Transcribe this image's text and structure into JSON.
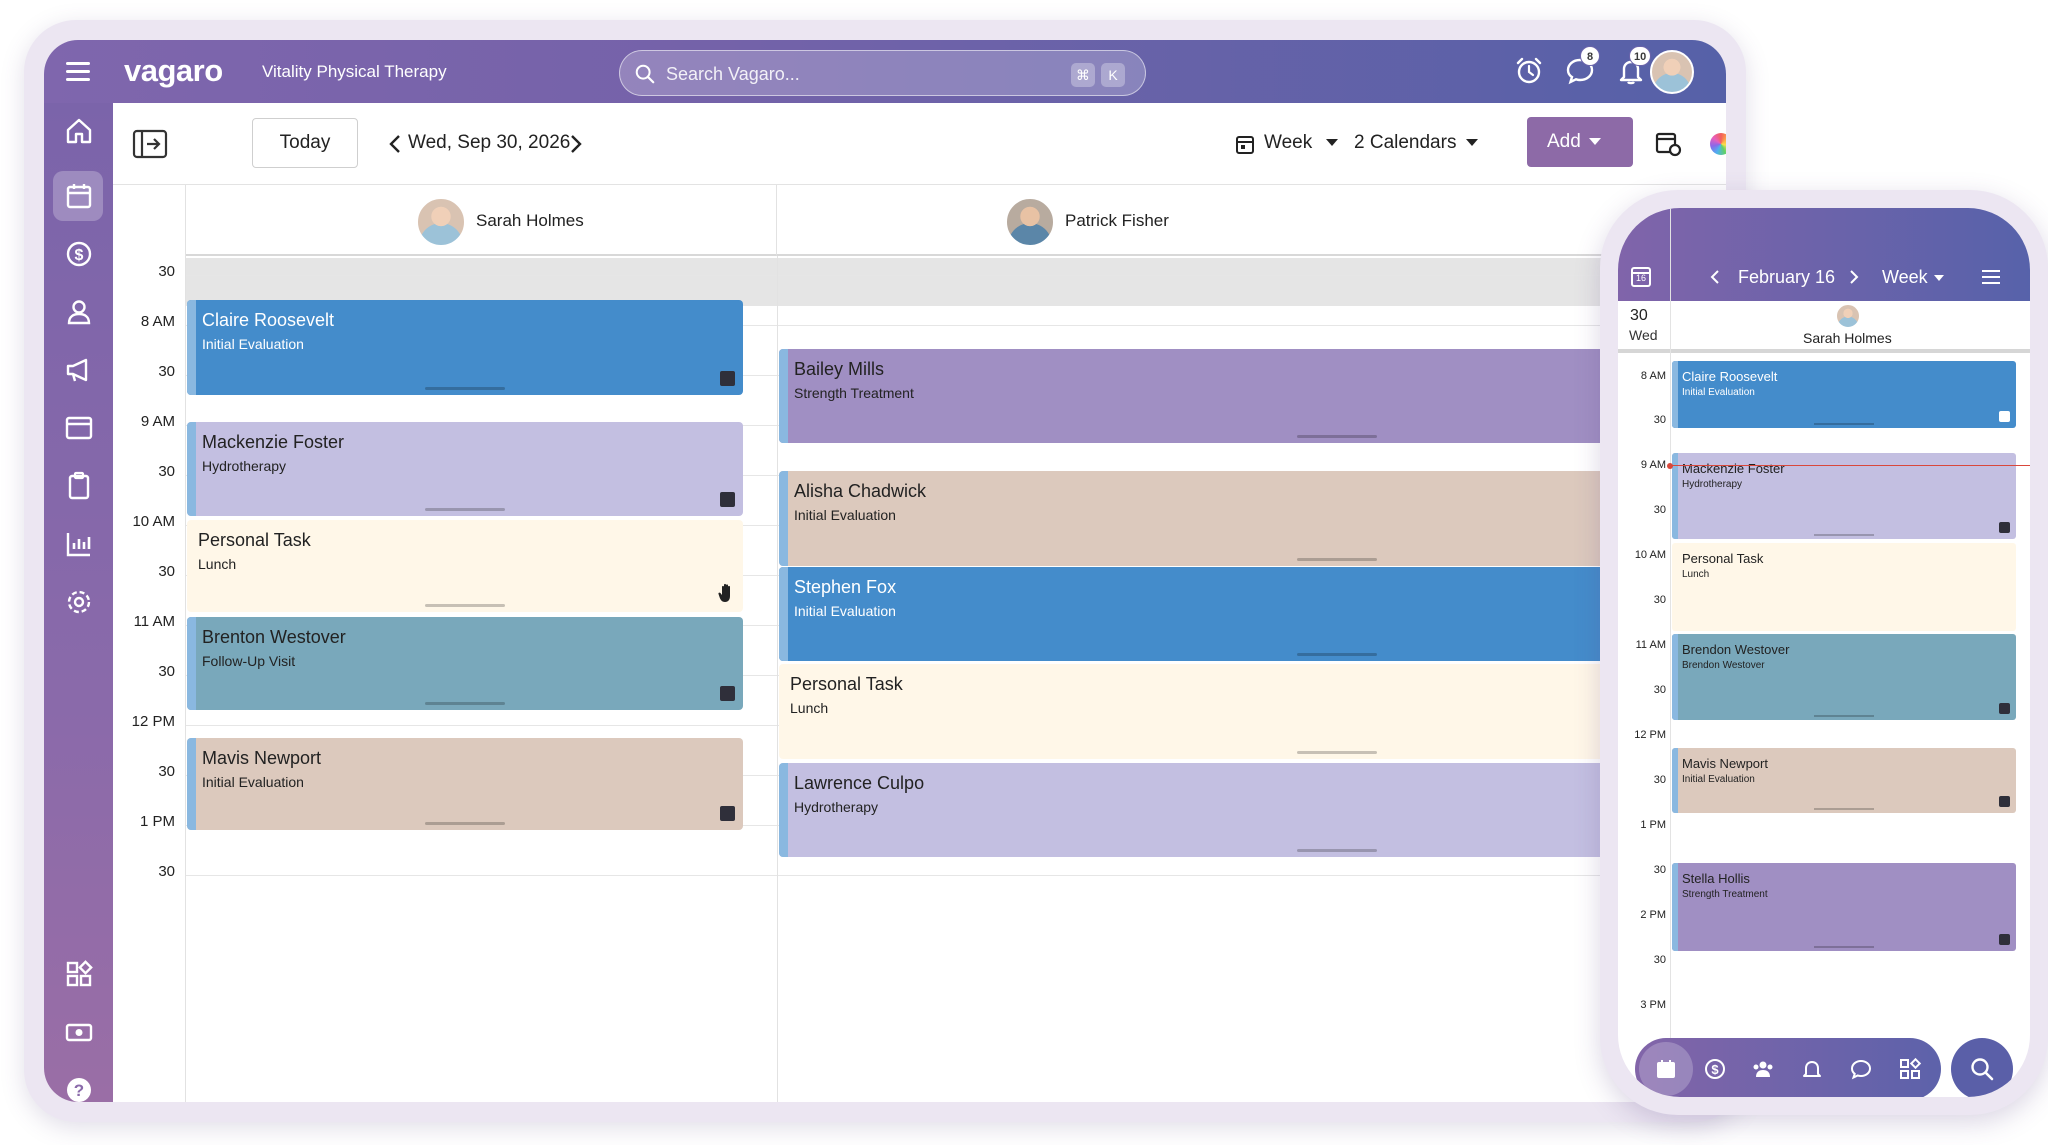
{
  "colors": {
    "blue": "#448ccb",
    "purple": "#a08fc3",
    "lavender": "#c3bfe1",
    "beige": "#fff7e8",
    "teal": "#79a8bb",
    "tan": "#dcc9bd",
    "accent": "#8d6aa7"
  },
  "topbar": {
    "logo": "vagaro",
    "business_name": "Vitality Physical Therapy",
    "search_placeholder": "Search Vagaro...",
    "shortcut_cmd": "⌘",
    "shortcut_key": "K",
    "messages_count": "8",
    "notifications_count": "10"
  },
  "toolbar": {
    "today": "Today",
    "date": "Wed, Sep 30, 2026",
    "view": "Week",
    "calendars": "2 Calendars",
    "add": "Add"
  },
  "calendar": {
    "staff": [
      {
        "name": "Sarah Holmes"
      },
      {
        "name": "Patrick Fisher"
      }
    ],
    "time_labels": [
      "30",
      "8 AM",
      "30",
      "9 AM",
      "30",
      "10 AM",
      "30",
      "11 AM",
      "30",
      "12 PM",
      "30",
      "1 PM",
      "30"
    ],
    "appointments_staff1": [
      {
        "name": "Claire Roosevelt",
        "service": "Initial Evaluation"
      },
      {
        "name": "Mackenzie Foster",
        "service": "Hydrotherapy"
      },
      {
        "name": "Personal Task",
        "service": "Lunch"
      },
      {
        "name": "Brenton Westover",
        "service": "Follow-Up Visit"
      },
      {
        "name": "Mavis Newport",
        "service": "Initial Evaluation"
      }
    ],
    "appointments_staff2": [
      {
        "name": "Bailey Mills",
        "service": "Strength Treatment"
      },
      {
        "name": "Alisha Chadwick",
        "service": "Initial Evaluation"
      },
      {
        "name": "Stephen Fox",
        "service": "Initial Evaluation"
      },
      {
        "name": "Personal Task",
        "service": "Lunch"
      },
      {
        "name": "Lawrence Culpo",
        "service": "Hydrotherapy"
      }
    ]
  },
  "phone": {
    "calendar_day": "16",
    "month_label": "February 16",
    "view": "Week",
    "day_number": "30",
    "day_name": "Wed",
    "staff_name": "Sarah Holmes",
    "time_labels": [
      "8 AM",
      "30",
      "9 AM",
      "30",
      "10 AM",
      "30",
      "11 AM",
      "30",
      "12 PM",
      "30",
      "1 PM",
      "30",
      "2 PM",
      "30",
      "3 PM"
    ],
    "appointments": [
      {
        "name": "Claire Roosevelt",
        "service": "Initial Evaluation"
      },
      {
        "name": "Mackenzie Foster",
        "service": "Hydrotherapy"
      },
      {
        "name": "Personal Task",
        "service": "Lunch"
      },
      {
        "name": "Brendon Westover",
        "service": "Brendon Westover"
      },
      {
        "name": "Mavis Newport",
        "service": "Initial Evaluation"
      },
      {
        "name": "Stella Hollis",
        "service": "Strength Treatment"
      }
    ]
  }
}
